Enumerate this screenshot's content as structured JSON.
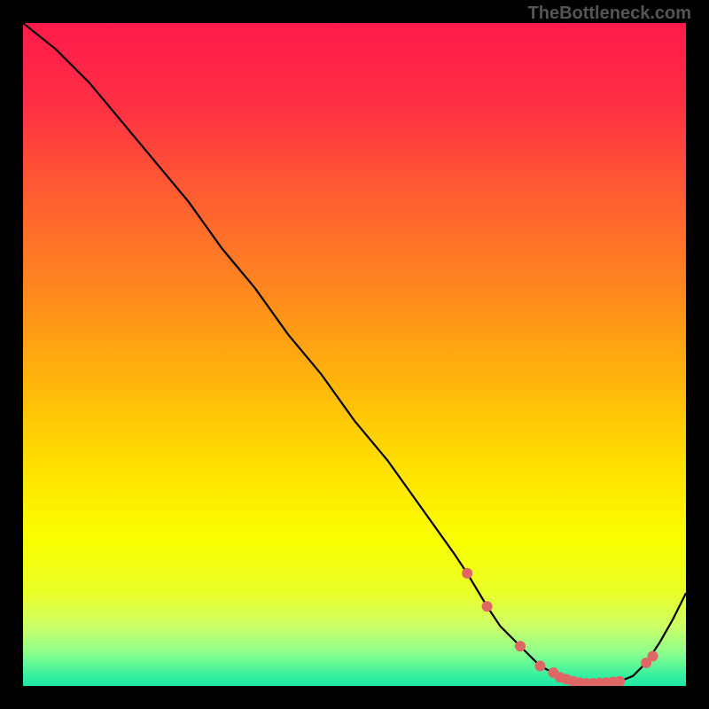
{
  "attribution": "TheBottleneck.com",
  "chart_data": {
    "type": "line",
    "title": "",
    "xlabel": "",
    "ylabel": "",
    "xlim": [
      0,
      100
    ],
    "ylim": [
      0,
      100
    ],
    "curve": {
      "name": "bottleneck-curve",
      "x": [
        0,
        5,
        10,
        15,
        20,
        25,
        30,
        35,
        40,
        45,
        50,
        55,
        60,
        65,
        67,
        70,
        72,
        75,
        78,
        80,
        82,
        83,
        84,
        85,
        86,
        88,
        90,
        92,
        94,
        96,
        98,
        100
      ],
      "y": [
        100,
        96,
        91,
        85,
        79,
        73,
        66,
        60,
        53,
        47,
        40,
        34,
        27,
        20,
        17,
        12,
        9,
        6,
        3,
        2,
        1,
        0.7,
        0.5,
        0.4,
        0.4,
        0.5,
        0.7,
        1.5,
        3.5,
        6.5,
        10,
        14
      ]
    },
    "markers": {
      "name": "bottleneck-points",
      "x": [
        67,
        70,
        75,
        78,
        80,
        81,
        82,
        83,
        84,
        85,
        86,
        87,
        88,
        89,
        90,
        94,
        95
      ],
      "y": [
        17,
        12,
        6,
        3,
        2,
        1.3,
        1,
        0.7,
        0.5,
        0.4,
        0.4,
        0.45,
        0.5,
        0.6,
        0.7,
        3.5,
        4.5
      ]
    },
    "gradient_stops": [
      {
        "offset": 0.0,
        "color": "#ff1a4b"
      },
      {
        "offset": 0.12,
        "color": "#ff2f44"
      },
      {
        "offset": 0.25,
        "color": "#ff5a33"
      },
      {
        "offset": 0.4,
        "color": "#ff871f"
      },
      {
        "offset": 0.55,
        "color": "#ffb80a"
      },
      {
        "offset": 0.68,
        "color": "#ffe400"
      },
      {
        "offset": 0.78,
        "color": "#faff00"
      },
      {
        "offset": 0.86,
        "color": "#eaff2a"
      },
      {
        "offset": 0.91,
        "color": "#ccff66"
      },
      {
        "offset": 0.95,
        "color": "#8dff8d"
      },
      {
        "offset": 0.985,
        "color": "#34f09e"
      },
      {
        "offset": 1.0,
        "color": "#1ee6a8"
      }
    ],
    "marker_color": "#e06666",
    "line_color": "#000000"
  }
}
